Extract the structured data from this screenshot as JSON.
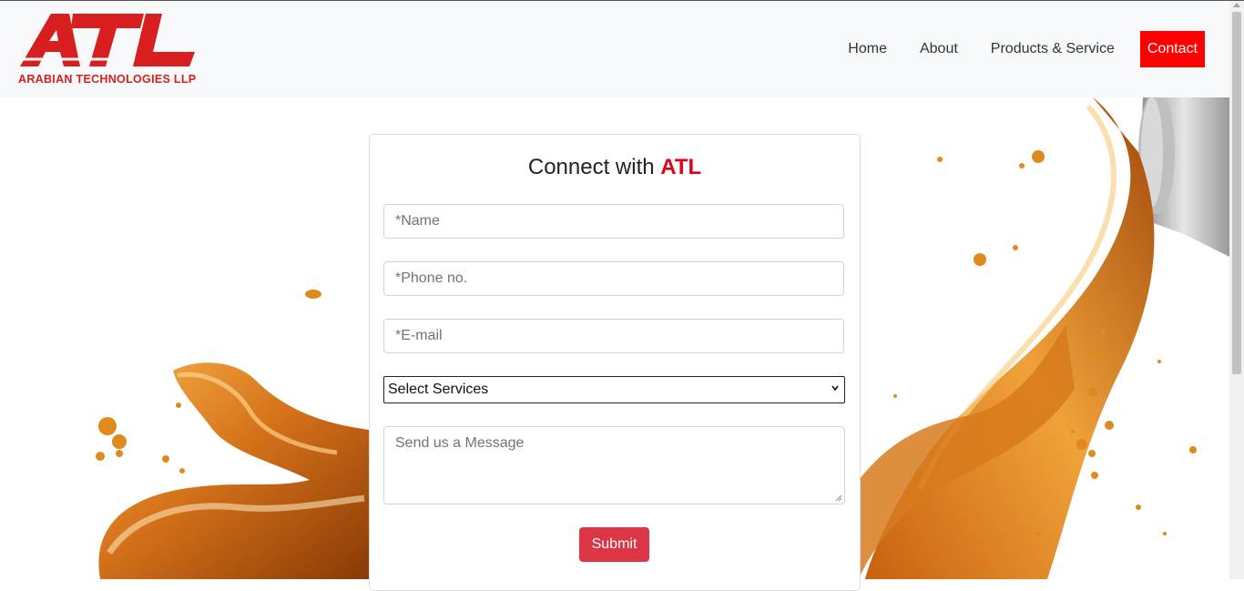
{
  "brand": {
    "logo_letters": "ATL",
    "company_name": "ARABIAN TECHNOLOGIES LLP",
    "color": "#d81e1e"
  },
  "nav": {
    "items": [
      {
        "label": "Home"
      },
      {
        "label": "About"
      },
      {
        "label": "Products & Service"
      },
      {
        "label": "Contact"
      }
    ],
    "active_color": "#ff0000"
  },
  "form": {
    "title_prefix": "Connect with ",
    "title_brand": "ATL",
    "name_placeholder": "*Name",
    "phone_placeholder": "*Phone no.",
    "email_placeholder": "*E-mail",
    "service_select": "Select Services",
    "message_placeholder": "Send us a Message",
    "submit_label": "Submit",
    "submit_color": "#dc3545"
  },
  "hero": {
    "image": "golden-oil-splash",
    "accent": "#e08a1e"
  }
}
